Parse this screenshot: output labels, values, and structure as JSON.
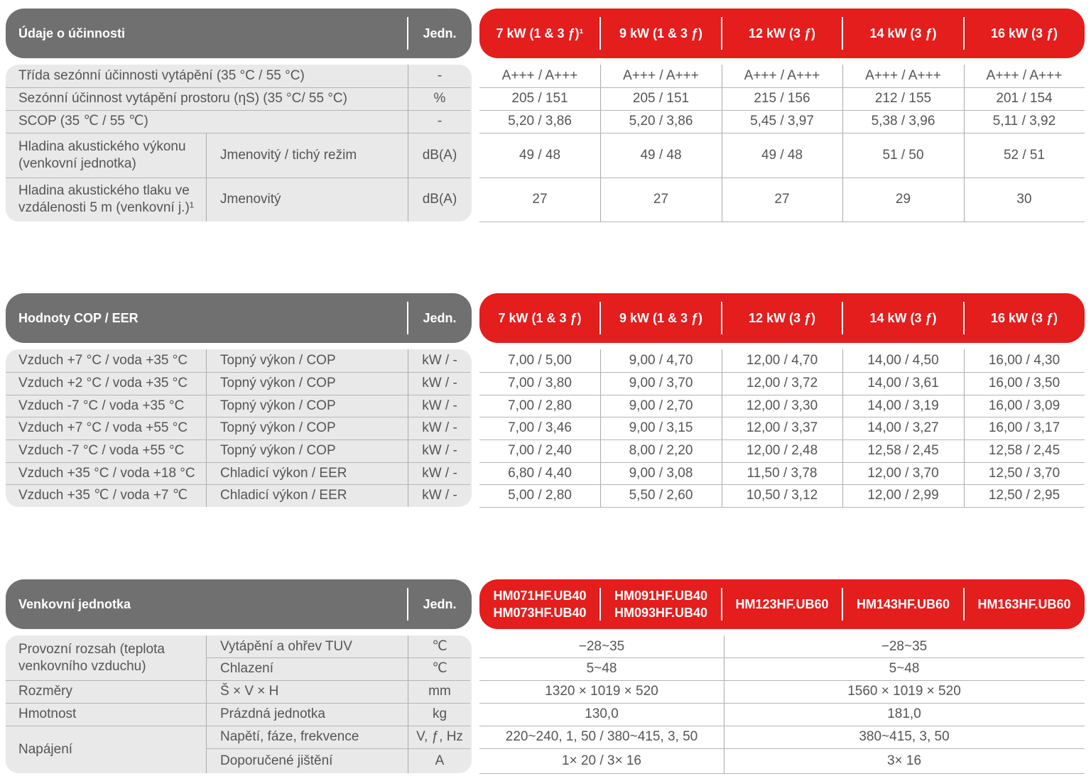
{
  "sections": [
    {
      "title": "Údaje o účinnosti",
      "unit_label": "Jedn.",
      "columns": [
        "7 kW (1 & 3 ƒ)¹",
        "9 kW (1 & 3 ƒ)",
        "12 kW (3 ƒ)",
        "14 kW (3 ƒ)",
        "16 kW (3 ƒ)"
      ],
      "rows": [
        {
          "label": "Třída sezónní účinnosti vytápění (35 °C / 55 °C)",
          "unit": "-",
          "values": [
            "A+++ / A+++",
            "A+++ / A+++",
            "A+++ / A+++",
            "A+++ / A+++",
            "A+++ / A+++"
          ]
        },
        {
          "label": "Sezónní účinnost vytápění prostoru (ηS) (35 °C/ 55 °C)",
          "unit": "%",
          "values": [
            "205 / 151",
            "205 / 151",
            "215 / 156",
            "212 / 155",
            "201 / 154"
          ]
        },
        {
          "label": "SCOP (35 ℃ / 55 ℃)",
          "unit": "-",
          "values": [
            "5,20 / 3,86",
            "5,20 / 3,86",
            "5,45 / 3,97",
            "5,38 / 3,96",
            "5,11 / 3,92"
          ]
        },
        {
          "label": "Hladina akustického výkonu (venkovní jednotka)",
          "sub": "Jmenovitý / tichý režim",
          "unit": "dB(A)",
          "values": [
            "49 / 48",
            "49 / 48",
            "49 / 48",
            "51 / 50",
            "52 / 51"
          ]
        },
        {
          "label": "Hladina akustického tlaku ve vzdálenosti 5 m (venkovní j.)¹",
          "sub": "Jmenovitý",
          "unit": "dB(A)",
          "values": [
            "27",
            "27",
            "27",
            "29",
            "30"
          ]
        }
      ]
    },
    {
      "title": "Hodnoty COP / EER",
      "unit_label": "Jedn.",
      "columns": [
        "7 kW (1 & 3 ƒ)",
        "9 kW (1 & 3 ƒ)",
        "12 kW (3 ƒ)",
        "14 kW (3 ƒ)",
        "16 kW (3 ƒ)"
      ],
      "rows": [
        {
          "label": "Vzduch +7 °C / voda +35 °C",
          "sub": "Topný výkon / COP",
          "unit": "kW / -",
          "values": [
            "7,00 / 5,00",
            "9,00 / 4,70",
            "12,00 / 4,70",
            "14,00 / 4,50",
            "16,00 / 4,30"
          ]
        },
        {
          "label": "Vzduch +2 °C / voda +35 °C",
          "sub": "Topný výkon / COP",
          "unit": "kW / -",
          "values": [
            "7,00 / 3,80",
            "9,00 / 3,70",
            "12,00 / 3,72",
            "14,00 / 3,61",
            "16,00 / 3,50"
          ]
        },
        {
          "label": "Vzduch -7 °C / voda +35 °C",
          "sub": "Topný výkon / COP",
          "unit": "kW / -",
          "values": [
            "7,00 / 2,80",
            "9,00 / 2,70",
            "12,00 / 3,30",
            "14,00 / 3,19",
            "16,00 / 3,09"
          ]
        },
        {
          "label": "Vzduch +7 °C / voda +55 °C",
          "sub": "Topný výkon / COP",
          "unit": "kW / -",
          "values": [
            "7,00 / 3,46",
            "9,00 / 3,15",
            "12,00 / 3,37",
            "14,00 / 3,27",
            "16,00 / 3,17"
          ]
        },
        {
          "label": "Vzduch -7 °C / voda +55 °C",
          "sub": "Topný výkon / COP",
          "unit": "kW / -",
          "values": [
            "7,00 / 2,40",
            "8,00 / 2,20",
            "12,00 / 2,48",
            "12,58 / 2,45",
            "12,58 / 2,45"
          ]
        },
        {
          "label": "Vzduch +35 °C / voda +18 °C",
          "sub": "Chladicí výkon / EER",
          "unit": "kW / -",
          "values": [
            "6,80 / 4,40",
            "9,00 / 3,08",
            "11,50 / 3,78",
            "12,00 / 3,70",
            "12,50 / 3,70"
          ]
        },
        {
          "label": "Vzduch +35 ℃ / voda +7 ℃",
          "sub": "Chladicí výkon / EER",
          "unit": "kW / -",
          "values": [
            "5,00 / 2,80",
            "5,50 / 2,60",
            "10,50 / 3,12",
            "12,00 / 2,99",
            "12,50 / 2,95"
          ]
        }
      ]
    },
    {
      "title": "Venkovní jednotka",
      "unit_label": "Jedn.",
      "columns": [
        "HM071HF.UB40\nHM073HF.UB40",
        "HM091HF.UB40\nHM093HF.UB40",
        "HM123HF.UB60",
        "HM143HF.UB60",
        "HM163HF.UB60"
      ],
      "rows": [
        {
          "label": "Provozní rozsah (teplota venkovního vzduchu)",
          "sub": "Vytápění a ohřev TUV",
          "unit": "℃",
          "values": [
            "−28~35",
            "−28~35"
          ]
        },
        {
          "sub": "Chlazení",
          "unit": "℃",
          "values": [
            "5~48",
            "5~48"
          ]
        },
        {
          "label": "Rozměry",
          "sub": "Š × V × H",
          "unit": "mm",
          "values": [
            "1320 × 1019 × 520",
            "1560 × 1019 × 520"
          ]
        },
        {
          "label": "Hmotnost",
          "sub": "Prázdná jednotka",
          "unit": "kg",
          "values": [
            "130,0",
            "181,0"
          ]
        },
        {
          "label": "Napájení",
          "sub": "Napětí, fáze, frekvence",
          "unit": "V, ƒ, Hz",
          "values": [
            "220~240, 1, 50 / 380~415, 3, 50",
            "380~415, 3, 50"
          ]
        },
        {
          "sub": "Doporučené jištění",
          "unit": "A",
          "values": [
            "1× 20 / 3× 16",
            "3× 16"
          ]
        }
      ]
    }
  ]
}
